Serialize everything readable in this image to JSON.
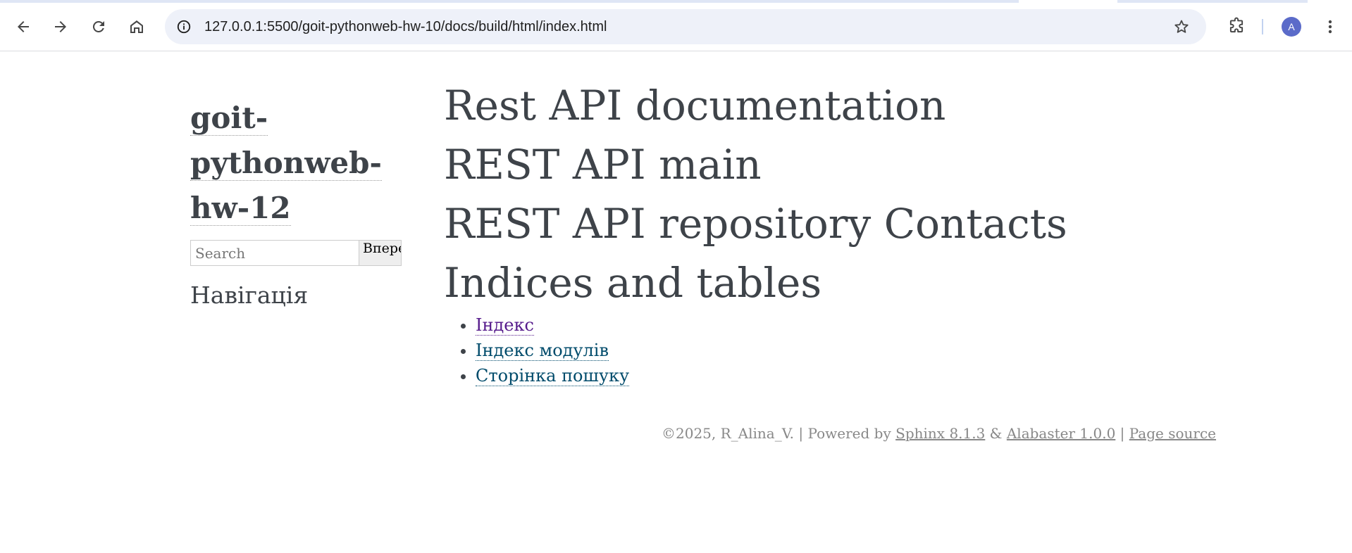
{
  "browser": {
    "url": "127.0.0.1:5500/goit-pythonweb-hw-10/docs/build/html/index.html",
    "profile_initial": "A",
    "icons": {
      "back": "arrow-left-icon",
      "forward": "arrow-right-icon",
      "reload": "reload-icon",
      "home": "home-icon",
      "site_info": "info-icon",
      "bookmark": "star-icon",
      "extensions": "puzzle-icon",
      "menu": "kebab-menu-icon"
    }
  },
  "sidebar": {
    "brand_line1": "goit-",
    "brand_line2": "pythonweb-",
    "brand_line3": "hw-12",
    "search_placeholder": "Search",
    "search_button": "Вперед",
    "nav_heading": "Навігація"
  },
  "main": {
    "headings": [
      "Rest API documentation",
      "REST API main",
      "REST API repository Contacts",
      "Indices and tables"
    ],
    "links": [
      "Індекс",
      "Індекс модулів",
      "Сторінка пошуку"
    ]
  },
  "footer": {
    "copyright": "©2025, R_Alina_V. | Powered by ",
    "sphinx": "Sphinx 8.1.3",
    "amp": " & ",
    "alabaster": "Alabaster 1.0.0",
    "sep": " | ",
    "source": "Page source"
  },
  "colors": {
    "text": "#3e4349",
    "link": "#004b6b",
    "visited_link": "#551a8b",
    "footer": "#888888",
    "avatar": "#5b6bc9"
  }
}
